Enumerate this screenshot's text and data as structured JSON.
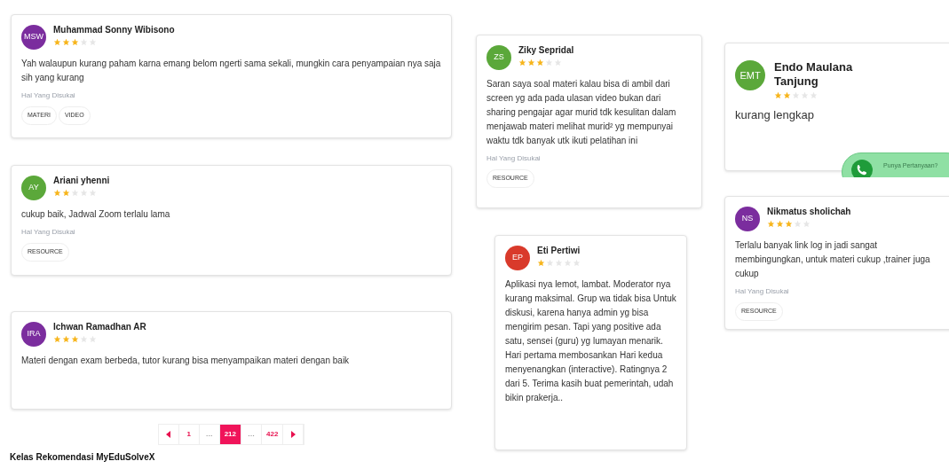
{
  "columns": [
    {
      "reviews": [
        {
          "kind": "normal",
          "initials": "MSW",
          "color": "#7b2d9e",
          "name": "Muhammad Sonny Wibisono",
          "stars": 3,
          "text": "Yah walaupun kurang paham karna emang belom ngerti sama sekali, mungkin cara penyampaian nya saja sih yang kurang",
          "liked_label": "Hal Yang Disukai",
          "tags": [
            "MATERI",
            "VIDEO"
          ]
        },
        {
          "kind": "normal",
          "initials": "AY",
          "color": "#5ba83a",
          "name": "Ariani yhenni",
          "stars": 2,
          "text": "cukup baik, Jadwal Zoom terlalu lama",
          "liked_label": "Hal Yang Disukai",
          "tags": [
            "RESOURCE"
          ]
        },
        {
          "kind": "normal",
          "initials": "IRA",
          "color": "#7b2d9e",
          "name": "Ichwan Ramadhan AR",
          "stars": 3,
          "text": "Materi dengan exam berbeda, tutor kurang bisa menyampaikan materi dengan baik"
        }
      ]
    },
    {
      "reviews": [
        {
          "kind": "normal",
          "initials": "ZS",
          "color": "#5ba83a",
          "name": "Ziky Sepridal",
          "stars": 3,
          "text": "Saran saya soal materi kalau bisa di ambil dari screen yg ada pada ulasan video bukan dari sharing pengajar agar murid tdk kesulitan dalam menjawab materi melihat murid² yg mempunyai waktu tdk banyak utk ikuti pelatihan ini",
          "liked_label": "Hal Yang Disukai",
          "tags": [
            "RESOURCE"
          ]
        },
        {
          "kind": "normal",
          "initials": "EP",
          "color": "#d93a2b",
          "name": "Eti Pertiwi",
          "stars": 1,
          "text": "Aplikasi nya lemot, lambat. Moderator nya kurang maksimal. Grup wa tidak bisa Untuk diskusi, karena hanya admin yg bisa mengirim pesan. Tapi yang positive ada satu, sensei (guru) yg lumayan menarik. Hari pertama membosankan Hari kedua menyenangkan (interactive). Ratingnya 2 dari 5. Terima kasih buat pemerintah, udah bikin prakerja.."
        }
      ]
    },
    {
      "reviews": [
        {
          "kind": "large",
          "initials": "EMT",
          "color": "#5ba83a",
          "name": "Endo Maulana Tanjung",
          "stars": 2,
          "text": "kurang lengkap"
        },
        {
          "kind": "normal",
          "initials": "NS",
          "color": "#7b2d9e",
          "name": "Nikmatus sholichah",
          "stars": 3,
          "text": "Terlalu banyak link log in jadi sangat membingungkan, untuk materi cukup ,trainer juga cukup",
          "liked_label": "Hal Yang Disukai",
          "tags": [
            "RESOURCE"
          ]
        }
      ]
    }
  ],
  "pagination": [
    {
      "kind": "prev",
      "selected": false
    },
    {
      "kind": "page",
      "label": "1",
      "selected": false
    },
    {
      "kind": "ellipsis",
      "label": "…",
      "selected": false
    },
    {
      "kind": "page",
      "label": "212",
      "selected": true
    },
    {
      "kind": "ellipsis",
      "label": "…",
      "selected": false
    },
    {
      "kind": "page",
      "label": "422",
      "selected": false
    },
    {
      "kind": "next",
      "selected": false
    }
  ],
  "section_heading": "Kelas Rekomendasi MyEduSolveX",
  "chat_widget": {
    "text": "Punya Pertanyaan?"
  }
}
